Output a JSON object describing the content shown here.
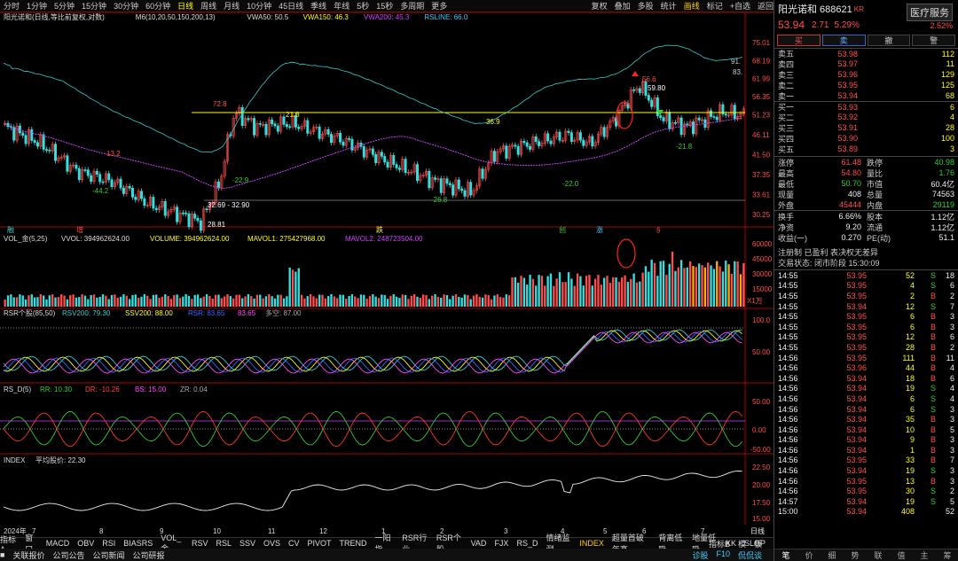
{
  "toolbar": {
    "periods": [
      "分时",
      "1分钟",
      "5分钟",
      "15分钟",
      "30分钟",
      "60分钟",
      "日线",
      "周线",
      "月线",
      "10分钟",
      "45日线",
      "季线",
      "年线",
      "5秒",
      "15秒",
      "多周期",
      "更多"
    ],
    "active": "日线",
    "tools": [
      "复权",
      "叠加",
      "多股",
      "统计",
      "画线",
      "标记",
      "+自选",
      "返回"
    ],
    "highlight_tool": "画线"
  },
  "main": {
    "title_line": "阳光诺和(日线,等比前复权,对数)",
    "ma": "M6(10,20,50,150,200,13)",
    "vwa50": "VWA50: 50.5",
    "vwa150": "VWA150: 46.3",
    "vwa200": "VWA200: 45.3",
    "rsline": "RSLINE: 66.0",
    "y_labels": [
      "75.01",
      "68.19",
      "61.99",
      "56.35",
      "51.23",
      "46.11",
      "41.50",
      "37.35",
      "33.61",
      "30.25"
    ],
    "side_labels": [
      "91.",
      "83."
    ],
    "annotations": [
      "72.8",
      "21.8",
      "13.2",
      "-44.2",
      "-22.9",
      "36.9",
      "56.6",
      "59.80",
      "-21.8",
      "-26.8",
      "-22.0",
      "32.69 - 32.90",
      "28.81"
    ],
    "icon_labels": [
      "融",
      "增",
      "跌",
      "创",
      "涨",
      "§"
    ]
  },
  "vol": {
    "title": "VOL_金(5,25)",
    "vvol": "VVOL: 394962624.00",
    "volume": "VOLUME: 394962624.00",
    "mavol1": "MAVOL1: 275427968.00",
    "mavol2": "MAVOL2: 248723504.00",
    "y_labels": [
      "60000",
      "45000",
      "30000",
      "15000"
    ],
    "unit": "X1万"
  },
  "rsr": {
    "title": "RSR个股(85,50)",
    "rsv": "RSV200: 79.30",
    "ssv": "SSV200: 88.00",
    "rsr": "RSR: 83.65",
    "val": "83.65",
    "duokong": "多空: 87.00",
    "y_labels": [
      "100.0",
      "50.00"
    ]
  },
  "rsd": {
    "title": "RS_D(5)",
    "rr": "RR: 10.30",
    "dr": "DR: -10.26",
    "bs": "BS: 15.00",
    "zr": "ZR: 0.04",
    "y_labels": [
      "50.00",
      "0.00",
      "-50.00"
    ]
  },
  "idx": {
    "title": "INDEX",
    "avg": "平均股价: 22.30",
    "y_labels": [
      "22.50",
      "20.00",
      "17.50",
      "15.00"
    ]
  },
  "xaxis": [
    "2024年",
    "7",
    "8",
    "9",
    "10",
    "11",
    "12",
    "1",
    "2",
    "3",
    "4",
    "5",
    "6",
    "7",
    "日线"
  ],
  "tabs1": [
    "指标A",
    "窗口",
    "MACD",
    "OBV",
    "RSI",
    "BIASRS",
    "VOL_金",
    "RSV",
    "RSL",
    "SSV",
    "OVS",
    "CV",
    "PIVOT",
    "TREND",
    "一阳指",
    "RSR行业",
    "RSR个股",
    "VAD",
    "FJX",
    "RS_D",
    "情绪监测",
    "INDEX",
    "超量首破年高",
    "背离低吸",
    "地量低吸",
    "KK",
    "SLOP"
  ],
  "tabs1_active": "INDEX",
  "tabs1_right": [
    "指标B",
    "模",
    "板"
  ],
  "tabs2": [
    "关联报价",
    "公司公告",
    "公司新闻",
    "公司研报"
  ],
  "tabs2_right": [
    "诊股",
    "F10",
    "侃侃谈"
  ],
  "quote": {
    "name": "阳光诺和 688621",
    "kr": "KR",
    "price": "53.94",
    "change": "2.71",
    "pct": "5.29%",
    "sector": "医疗服务",
    "sector_pct": "2.52%",
    "btns": [
      "买",
      "卖",
      "撤",
      "警"
    ],
    "asks": [
      [
        "卖五",
        "53.98",
        "112"
      ],
      [
        "卖四",
        "53.97",
        "11"
      ],
      [
        "卖三",
        "53.96",
        "129"
      ],
      [
        "卖二",
        "53.95",
        "125"
      ],
      [
        "卖一",
        "53.94",
        "68"
      ]
    ],
    "bids": [
      [
        "买一",
        "53.93",
        "6"
      ],
      [
        "买二",
        "53.92",
        "4"
      ],
      [
        "买三",
        "53.91",
        "28"
      ],
      [
        "买四",
        "53.90",
        "100"
      ],
      [
        "买五",
        "53.89",
        "3"
      ]
    ],
    "stats": [
      [
        "涨停",
        "61.48",
        "跌停",
        "40.98"
      ],
      [
        "最高",
        "54.80",
        "量比",
        "1.76"
      ],
      [
        "最低",
        "50.70",
        "市值",
        "60.4亿"
      ],
      [
        "现量",
        "408",
        "总量",
        "74563"
      ],
      [
        "外盘",
        "45444",
        "内盘",
        "29119"
      ]
    ],
    "stats2": [
      [
        "换手",
        "6.66%",
        "股本",
        "1.12亿"
      ],
      [
        "净资",
        "9.20",
        "流通",
        "1.12亿"
      ],
      [
        "收益(一)",
        "0.270",
        "PE(动)",
        "51.1"
      ]
    ],
    "reg": "注册制 已盈利 表决权无差异",
    "status": "交易状态: 闭市阶段 15:30:09"
  },
  "ticks": [
    [
      "14:55",
      "53.95",
      "52",
      "S",
      "18"
    ],
    [
      "14:55",
      "53.95",
      "4",
      "S",
      "6"
    ],
    [
      "14:55",
      "53.95",
      "2",
      "B",
      "2"
    ],
    [
      "14:55",
      "53.94",
      "12",
      "S",
      "7"
    ],
    [
      "14:55",
      "53.95",
      "6",
      "B",
      "3"
    ],
    [
      "14:55",
      "53.95",
      "6",
      "B",
      "3"
    ],
    [
      "14:55",
      "53.95",
      "12",
      "B",
      "6"
    ],
    [
      "14:55",
      "53.95",
      "28",
      "B",
      "2"
    ],
    [
      "14:56",
      "53.95",
      "111",
      "B",
      "11"
    ],
    [
      "14:56",
      "53.96",
      "44",
      "B",
      "4"
    ],
    [
      "14:56",
      "53.94",
      "18",
      "B",
      "6"
    ],
    [
      "14:56",
      "53.94",
      "19",
      "S",
      "4"
    ],
    [
      "14:56",
      "53.94",
      "6",
      "S",
      "4"
    ],
    [
      "14:56",
      "53.94",
      "6",
      "S",
      "3"
    ],
    [
      "14:56",
      "53.94",
      "35",
      "B",
      "3"
    ],
    [
      "14:56",
      "53.94",
      "10",
      "B",
      "5"
    ],
    [
      "14:56",
      "53.94",
      "9",
      "B",
      "3"
    ],
    [
      "14:56",
      "53.94",
      "1",
      "B",
      "3"
    ],
    [
      "14:56",
      "53.95",
      "33",
      "B",
      "7"
    ],
    [
      "14:56",
      "53.94",
      "19",
      "S",
      "3"
    ],
    [
      "14:56",
      "53.95",
      "13",
      "B",
      "3"
    ],
    [
      "14:56",
      "53.95",
      "30",
      "S",
      "2"
    ],
    [
      "14:57",
      "53.94",
      "19",
      "S",
      "5"
    ],
    [
      "15:00",
      "53.94",
      "408",
      "",
      "52"
    ]
  ],
  "bottom_tabs": [
    "笔",
    "价",
    "细",
    "势",
    "联",
    "值",
    "主",
    "筹"
  ],
  "colors": {
    "up": "#ff4d4d",
    "down": "#33e0e0",
    "ma": "#ffff00",
    "vwa": "#d040ff"
  }
}
